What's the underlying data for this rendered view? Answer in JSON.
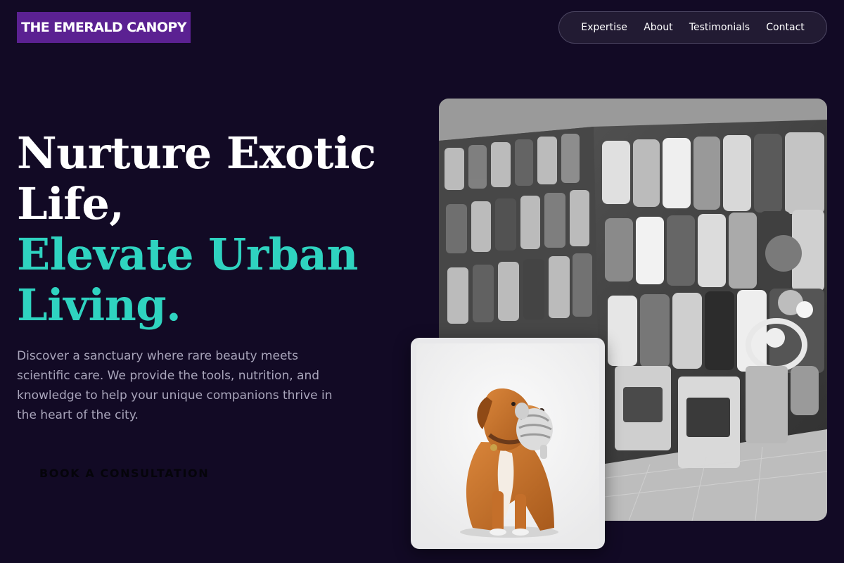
{
  "brand": {
    "name": "THE EMERALD CANOPY"
  },
  "nav": {
    "items": [
      {
        "label": "Expertise"
      },
      {
        "label": "About"
      },
      {
        "label": "Testimonials"
      },
      {
        "label": "Contact"
      }
    ]
  },
  "hero": {
    "headline_line1": "Nurture Exotic",
    "headline_line2": "Life,",
    "headline_line3": "Elevate Urban",
    "headline_line4": "Living.",
    "description": "Discover a sanctuary where rare beauty meets scientific care. We provide the tools, nutrition, and knowledge to help your unique companions thrive in the heart of the city.",
    "cta_label": "BOOK A CONSULTATION"
  },
  "images": {
    "store_photo": "pet-store-interior-photo",
    "dog_photo": "dog-holding-toy-photo"
  },
  "colors": {
    "background": "#120a25",
    "brand_purple": "#5b2192",
    "accent_teal": "#2fd3c0",
    "text_muted": "#a9a5bb"
  }
}
